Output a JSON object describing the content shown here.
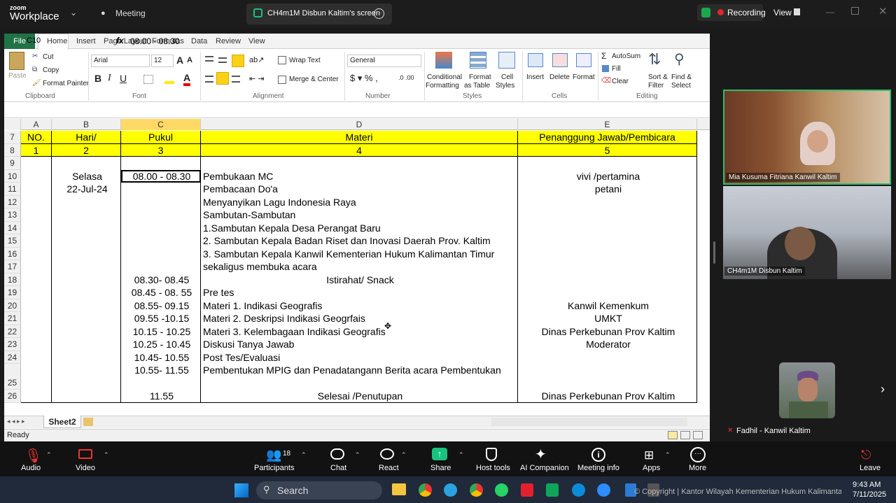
{
  "topbar": {
    "logo_small": "zoom",
    "logo_big": "Workplace",
    "meeting": "Meeting",
    "share_title": "CH4m1M Disbun Kaltim's screen",
    "recording": "Recording",
    "view": "View"
  },
  "excel": {
    "tabs": [
      "File",
      "Home",
      "Insert",
      "Page Layout",
      "Formulas",
      "Data",
      "Review",
      "View"
    ],
    "clipboard": {
      "paste": "Paste",
      "cut": "Cut",
      "copy": "Copy",
      "format_painter": "Format Painter",
      "group": "Clipboard"
    },
    "font": {
      "name": "Arial",
      "size": "12",
      "group": "Font"
    },
    "alignment": {
      "wrap": "Wrap Text",
      "merge": "Merge & Center",
      "group": "Alignment"
    },
    "number": {
      "format": "General",
      "group": "Number"
    },
    "styles": {
      "cond": "Conditional",
      "cond2": "Formatting",
      "fmt_table": "Format",
      "fmt_table2": "as Table",
      "cell_styles": "Cell",
      "cell_styles2": "Styles",
      "group": "Styles"
    },
    "cells": {
      "insert": "Insert",
      "delete": "Delete",
      "format": "Format",
      "group": "Cells"
    },
    "editing": {
      "autosum": "AutoSum",
      "fill": "Fill",
      "clear": "Clear",
      "sort": "Sort &",
      "sort2": "Filter",
      "find": "Find &",
      "find2": "Select",
      "group": "Editing"
    },
    "namebox": "C10",
    "fx": "fx",
    "formula": "08.00 - 08.30",
    "columns": [
      "A",
      "B",
      "C",
      "D",
      "E"
    ],
    "header_row7": {
      "a": "NO.",
      "b": "Hari/",
      "c": "Pukul",
      "d": "Materi",
      "e": "Penanggung Jawab/Pembicara"
    },
    "header_row8": {
      "a": "1",
      "b": "2",
      "c": "3",
      "d": "4",
      "e": "5"
    },
    "rows": [
      {
        "n": "9",
        "b": "",
        "c": "",
        "d": "",
        "e": ""
      },
      {
        "n": "10",
        "b": "Selasa",
        "c": "08.00 - 08.30",
        "d": "Pembukaan MC",
        "e": "vivi /pertamina"
      },
      {
        "n": "11",
        "b": "22-Jul-24",
        "c": "",
        "d": "Pembacaan Do'a",
        "e": "petani"
      },
      {
        "n": "12",
        "b": "",
        "c": "",
        "d": "Menyanyikan Lagu Indonesia Raya",
        "e": ""
      },
      {
        "n": "13",
        "b": "",
        "c": "",
        "d": "Sambutan-Sambutan",
        "e": ""
      },
      {
        "n": "14",
        "b": "",
        "c": "",
        "d": "1.Sambutan Kepala Desa Perangat Baru",
        "e": ""
      },
      {
        "n": "15",
        "b": "",
        "c": "",
        "d": "2.  Sambutan Kepala Badan Riset dan Inovasi Daerah Prov. Kaltim",
        "e": ""
      },
      {
        "n": "16",
        "b": "",
        "c": "",
        "d": "3. Sambutan Kepala Kanwil Kementerian Hukum  Kalimantan Timur",
        "e": ""
      },
      {
        "n": "17",
        "b": "",
        "c": "",
        "d": "    sekaligus membuka acara",
        "e": ""
      },
      {
        "n": "18",
        "b": "",
        "c": "08.30- 08.45",
        "d": "Istirahat/ Snack",
        "e": ""
      },
      {
        "n": "19",
        "b": "",
        "c": "08.45 - 08. 55",
        "d": "Pre tes",
        "e": ""
      },
      {
        "n": "20",
        "b": "",
        "c": "08.55- 09.15",
        "d": "Materi 1. Indikasi Geografis",
        "e": "Kanwil Kemenkum"
      },
      {
        "n": "21",
        "b": "",
        "c": "09.55 -10.15",
        "d": "Materi 2. Deskripsi Indikasi Geogrfais",
        "e": "UMKT"
      },
      {
        "n": "22",
        "b": "",
        "c": "10.15 - 10.25",
        "d": "Materi 3. Kelembagaan Indikasi Geografis",
        "e": "Dinas Perkebunan Prov Kaltim"
      },
      {
        "n": "23",
        "b": "",
        "c": "10.25  - 10.45",
        "d": "Diskusi Tanya Jawab",
        "e": "Moderator"
      },
      {
        "n": "24",
        "b": "",
        "c": "10.45- 10.55",
        "d": "Post Tes/Evaluasi",
        "e": ""
      },
      {
        "n": "25",
        "b": "",
        "c": "10.55- 11.55",
        "d": "Pembentukan MPIG dan Penadatangann Berita acara Pembentukan",
        "e": ""
      },
      {
        "n": "26",
        "b": "",
        "c": "11.55",
        "d": "Selesai /Penutupan",
        "e": "Dinas Perkebunan Prov Kaltim"
      }
    ],
    "sheet": "Sheet2",
    "status": "Ready"
  },
  "videos": {
    "v1": "Mia Kusuma Fitriana Kanwil Kaltim",
    "v2": "CH4m1M Disbun Kaltim",
    "v3": "Fadhil - Kanwil Kaltim"
  },
  "controls": {
    "audio": "Audio",
    "video": "Video",
    "participants": "Participants",
    "participants_count": "18",
    "chat": "Chat",
    "react": "React",
    "share": "Share",
    "host": "Host tools",
    "ai": "AI Companion",
    "info": "Meeting info",
    "apps": "Apps",
    "more": "More",
    "leave": "Leave"
  },
  "taskbar": {
    "search": "Search",
    "copyright": "© Copyright | Kantor Wilayah Kementerian Hukum Kalimantan Timur",
    "time": "9:43 AM",
    "date": "7/11/2025"
  }
}
